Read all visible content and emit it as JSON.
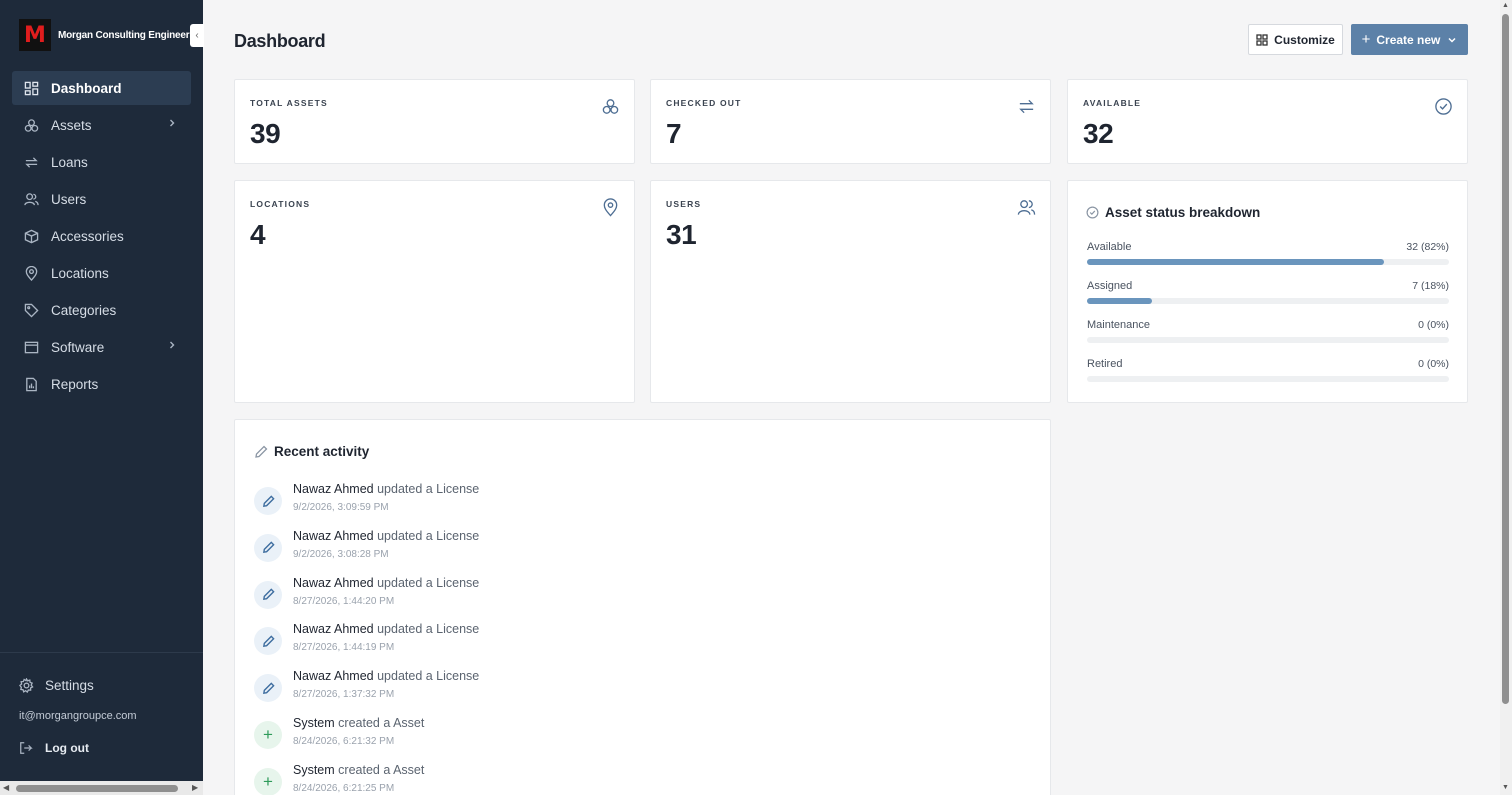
{
  "brand": {
    "logo_letter": "M",
    "name": "Morgan Consulting Engineers",
    "collapse_glyph": "‹"
  },
  "nav": [
    {
      "label": "Dashboard",
      "icon": "dashboard-icon",
      "active": true
    },
    {
      "label": "Assets",
      "icon": "assets-icon",
      "has_submenu": true
    },
    {
      "label": "Loans",
      "icon": "loans-icon"
    },
    {
      "label": "Users",
      "icon": "users-icon"
    },
    {
      "label": "Accessories",
      "icon": "box-icon"
    },
    {
      "label": "Locations",
      "icon": "location-pin-icon"
    },
    {
      "label": "Categories",
      "icon": "tag-icon"
    },
    {
      "label": "Software",
      "icon": "software-window-icon",
      "has_submenu": true
    },
    {
      "label": "Reports",
      "icon": "reports-icon"
    }
  ],
  "footer": {
    "settings_label": "Settings",
    "email": "it@morgangroupce.com",
    "logout_label": "Log out"
  },
  "header": {
    "title": "Dashboard",
    "customize_label": "Customize",
    "create_label": "Create new",
    "create_plus": "+"
  },
  "stats": [
    {
      "label": "TOTAL ASSETS",
      "value": "39",
      "icon": "assets-icon"
    },
    {
      "label": "CHECKED OUT",
      "value": "7",
      "icon": "swap-arrows-icon"
    },
    {
      "label": "AVAILABLE",
      "value": "32",
      "icon": "check-circle-icon"
    },
    {
      "label": "LOCATIONS",
      "value": "4",
      "icon": "location-pin-icon"
    },
    {
      "label": "USERS",
      "value": "31",
      "icon": "users-icon"
    }
  ],
  "breakdown": {
    "title": "Asset status breakdown",
    "rows": [
      {
        "label": "Available",
        "value": "32 (82%)",
        "fraction": 0.82
      },
      {
        "label": "Assigned",
        "value": "7 (18%)",
        "fraction": 0.18
      },
      {
        "label": "Maintenance",
        "value": "0 (0%)",
        "fraction": 0
      },
      {
        "label": "Retired",
        "value": "0 (0%)",
        "fraction": 0
      }
    ]
  },
  "activity": {
    "title": "Recent activity",
    "items": [
      {
        "actor": "Nawaz Ahmed",
        "action": "updated a License",
        "time": "9/2/2026, 3:09:59 PM",
        "kind": "edit"
      },
      {
        "actor": "Nawaz Ahmed",
        "action": "updated a License",
        "time": "9/2/2026, 3:08:28 PM",
        "kind": "edit"
      },
      {
        "actor": "Nawaz Ahmed",
        "action": "updated a License",
        "time": "8/27/2026, 1:44:20 PM",
        "kind": "edit"
      },
      {
        "actor": "Nawaz Ahmed",
        "action": "updated a License",
        "time": "8/27/2026, 1:44:19 PM",
        "kind": "edit"
      },
      {
        "actor": "Nawaz Ahmed",
        "action": "updated a License",
        "time": "8/27/2026, 1:37:32 PM",
        "kind": "edit"
      },
      {
        "actor": "System",
        "action": "created a Asset",
        "time": "8/24/2026, 6:21:32 PM",
        "kind": "add"
      },
      {
        "actor": "System",
        "action": "created a Asset",
        "time": "8/24/2026, 6:21:25 PM",
        "kind": "add"
      }
    ]
  },
  "scroll": {
    "up": "▲",
    "down": "▼",
    "left": "◀",
    "right": "▶"
  },
  "colors": {
    "sidebar": "#1e2a3a",
    "accent": "#5c81a8",
    "bar": "#6a95bd"
  }
}
